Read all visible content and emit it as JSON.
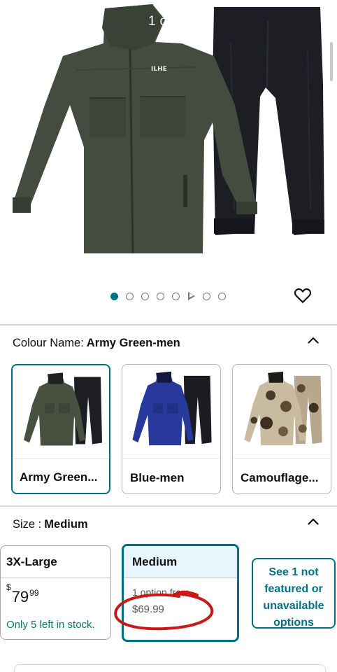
{
  "gallery": {
    "counter": "1 of 1",
    "dots": [
      "image",
      "image",
      "image",
      "image",
      "image",
      "video",
      "image",
      "image"
    ],
    "active_index": 0
  },
  "colour": {
    "label": "Colour Name:",
    "selected_value": "Army Green-men",
    "options": [
      {
        "name": "Army Green...",
        "selected": true
      },
      {
        "name": "Blue-men",
        "selected": false
      },
      {
        "name": "Camouflage...",
        "selected": false
      }
    ]
  },
  "size": {
    "label": "Size :",
    "selected_value": "Medium",
    "options": [
      {
        "name": "3X-Large",
        "price_symbol": "$",
        "price_whole": "79",
        "price_cents": "99",
        "stock": "Only 5 left in stock.",
        "selected": false
      },
      {
        "name": "Medium",
        "options_from": "1 option from",
        "price": "$69.99",
        "selected": true
      }
    ],
    "more_link": "See 1 not featured or unavailable options"
  },
  "colors": {
    "accent": "#007185",
    "stock_green": "#067d62",
    "army_green": "#48513f",
    "navy": "#27399a",
    "annotation_red": "#c81818"
  },
  "icons": {
    "wishlist": "heart-icon",
    "collapse": "chevron-up-icon"
  }
}
